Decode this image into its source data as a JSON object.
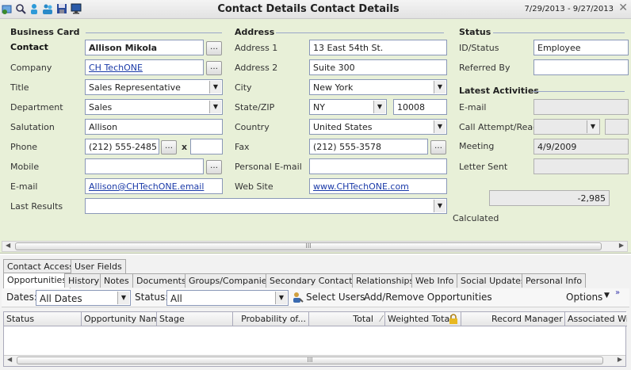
{
  "window": {
    "title": "Contact Details Contact Details",
    "date_range": "7/29/2013 - 9/27/2013"
  },
  "sections": {
    "business_card": "Business Card",
    "address": "Address",
    "status": "Status",
    "latest_activities": "Latest Activities"
  },
  "business": {
    "contact_label": "Contact",
    "contact_value": "Allison Mikola",
    "company_label": "Company",
    "company_value": "CH TechONE",
    "title_label": "Title",
    "title_value": "Sales Representative",
    "department_label": "Department",
    "department_value": "Sales",
    "salutation_label": "Salutation",
    "salutation_value": "Allison",
    "phone_label": "Phone",
    "phone_value": "(212) 555-2485",
    "phone_ext_label": "x",
    "phone_ext_value": "",
    "mobile_label": "Mobile",
    "mobile_value": "",
    "email_label": "E-mail",
    "email_value": "Allison@CHTechONE.email",
    "last_results_label": "Last Results",
    "last_results_value": ""
  },
  "address": {
    "address1_label": "Address 1",
    "address1_value": "13 East 54th St.",
    "address2_label": "Address 2",
    "address2_value": "Suite 300",
    "city_label": "City",
    "city_value": "New York",
    "statezip_label": "State/ZIP",
    "state_value": "NY",
    "zip_value": "10008",
    "country_label": "Country",
    "country_value": "United States",
    "fax_label": "Fax",
    "fax_value": "(212) 555-3578",
    "personal_email_label": "Personal E-mail",
    "personal_email_value": "",
    "website_label": "Web Site",
    "website_value": "www.CHTechONE.com"
  },
  "status": {
    "id_label": "ID/Status",
    "id_value": "Employee",
    "referred_label": "Referred By",
    "referred_value": ""
  },
  "activities": {
    "email_label": "E-mail",
    "email_value": "",
    "call_label": "Call Attempt/Reach",
    "call_value": "",
    "meeting_label": "Meeting",
    "meeting_value": "4/9/2009",
    "letter_label": "Letter Sent",
    "letter_value": "",
    "calculated_value": "-2,985",
    "calculated_label": "Calculated"
  },
  "tabs_row1": [
    "Contact Access",
    "User Fields"
  ],
  "tabs_row2": [
    "Opportunities",
    "History",
    "Notes",
    "Documents",
    "Groups/Companies",
    "Secondary Contacts",
    "Relationships",
    "Web Info",
    "Social Updates",
    "Personal Info"
  ],
  "toolbar": {
    "dates_label": "Dates:",
    "dates_value": "All Dates",
    "status_label": "Status:",
    "status_value": "All",
    "select_users": "Select Users",
    "add_remove": "Add/Remove Opportunities",
    "options": "Options"
  },
  "grid_columns": [
    "Status",
    "Opportunity Name",
    "Stage",
    "Probability of...",
    "Total",
    "Weighted Total",
    "Record Manager",
    "Associated Wi"
  ],
  "scroll_grip": "III",
  "icons": [
    "new-contact-icon",
    "lookup-icon",
    "person-icon",
    "group-icon",
    "save-icon",
    "monitor-icon"
  ]
}
